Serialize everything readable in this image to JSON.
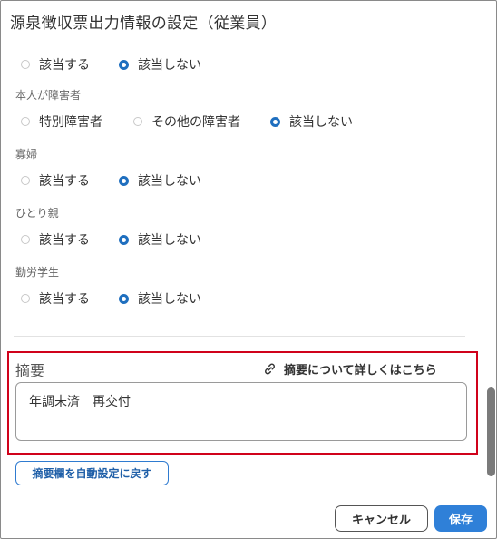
{
  "dialog": {
    "title": "源泉徴収票出力情報の設定（従業員）"
  },
  "sections": [
    {
      "label": "",
      "options": [
        {
          "label": "該当する",
          "selected": false
        },
        {
          "label": "該当しない",
          "selected": true
        }
      ]
    },
    {
      "label": "本人が障害者",
      "options": [
        {
          "label": "特別障害者",
          "selected": false
        },
        {
          "label": "その他の障害者",
          "selected": false
        },
        {
          "label": "該当しない",
          "selected": true
        }
      ]
    },
    {
      "label": "寡婦",
      "options": [
        {
          "label": "該当する",
          "selected": false
        },
        {
          "label": "該当しない",
          "selected": true
        }
      ]
    },
    {
      "label": "ひとり親",
      "options": [
        {
          "label": "該当する",
          "selected": false
        },
        {
          "label": "該当しない",
          "selected": true
        }
      ]
    },
    {
      "label": "勤労学生",
      "options": [
        {
          "label": "該当する",
          "selected": false
        },
        {
          "label": "該当しない",
          "selected": true
        }
      ]
    }
  ],
  "memo": {
    "label": "摘要",
    "link_text": "摘要について詳しくはこちら",
    "value": "年調未済　再交付"
  },
  "buttons": {
    "reset": "摘要欄を自動設定に戻す",
    "cancel": "キャンセル",
    "save": "保存"
  },
  "colors": {
    "accent": "#2f80d8",
    "highlight_border": "#d0021b"
  }
}
